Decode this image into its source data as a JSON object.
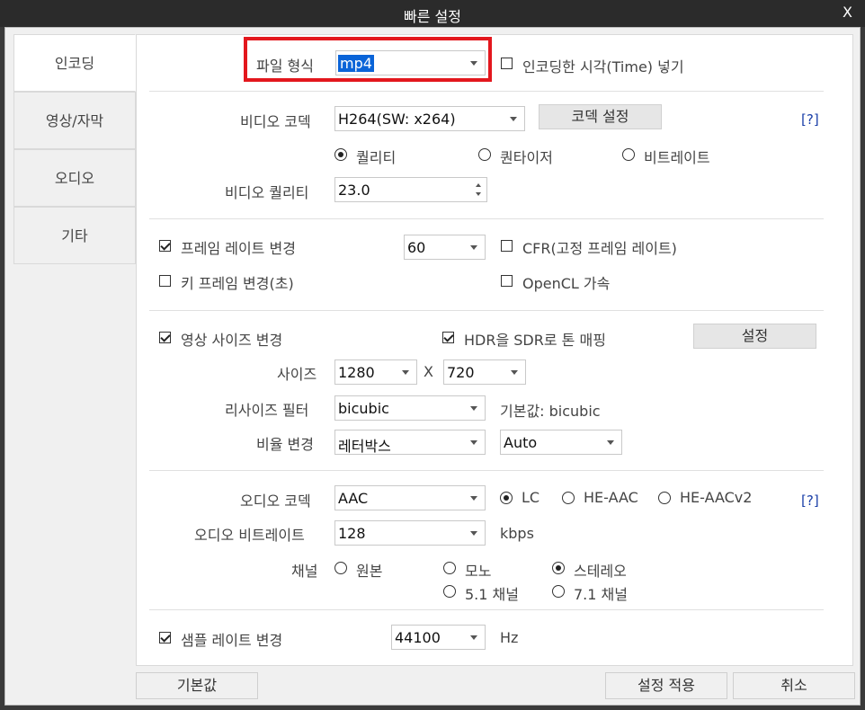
{
  "window": {
    "title": "빠른 설정",
    "close_label": "X"
  },
  "sidebar": {
    "items": [
      {
        "label": "인코딩"
      },
      {
        "label": "영상/자막"
      },
      {
        "label": "오디오"
      },
      {
        "label": "기타"
      }
    ]
  },
  "file_format": {
    "label": "파일 형식",
    "value": "mp4",
    "insert_time_label": "인코딩한 시각(Time) 넣기",
    "insert_time_checked": false
  },
  "video": {
    "codec_label": "비디오 코덱",
    "codec_value": "H264(SW: x264)",
    "codec_settings_button": "코덱 설정",
    "help_label": "[?]",
    "mode_options": [
      "퀄리티",
      "퀀타이저",
      "비트레이트"
    ],
    "mode_selected": "퀄리티",
    "quality_label": "비디오 퀄리티",
    "quality_value": "23.0"
  },
  "framerate": {
    "change_label": "프레임 레이트 변경",
    "change_checked": true,
    "value": "60",
    "cfr_label": "CFR(고정 프레임 레이트)",
    "cfr_checked": false,
    "keyframe_label": "키 프레임 변경(초)",
    "keyframe_checked": false,
    "opencl_label": "OpenCL 가속",
    "opencl_checked": false
  },
  "resize": {
    "change_label": "영상 사이즈 변경",
    "change_checked": true,
    "hdr_label": "HDR을 SDR로 톤 매핑",
    "hdr_checked": true,
    "settings_button": "설정",
    "size_label": "사이즈",
    "width": "1280",
    "x_label": "X",
    "height": "720",
    "filter_label": "리사이즈 필터",
    "filter_value": "bicubic",
    "filter_default": "기본값: bicubic",
    "ratio_label": "비율 변경",
    "ratio_value": "레터박스",
    "ratio_auto": "Auto"
  },
  "audio": {
    "codec_label": "오디오 코덱",
    "codec_value": "AAC",
    "profile_options": [
      "LC",
      "HE-AAC",
      "HE-AACv2"
    ],
    "profile_selected": "LC",
    "help_label": "[?]",
    "bitrate_label": "오디오 비트레이트",
    "bitrate_value": "128",
    "bitrate_unit": "kbps",
    "channel_label": "채널",
    "channel_options": [
      "원본",
      "모노",
      "스테레오",
      "5.1 채널",
      "7.1 채널"
    ],
    "channel_selected": "스테레오"
  },
  "samplerate": {
    "change_label": "샘플 레이트 변경",
    "change_checked": true,
    "value": "44100",
    "unit": "Hz"
  },
  "footer": {
    "default_button": "기본값",
    "apply_button": "설정 적용",
    "cancel_button": "취소"
  }
}
